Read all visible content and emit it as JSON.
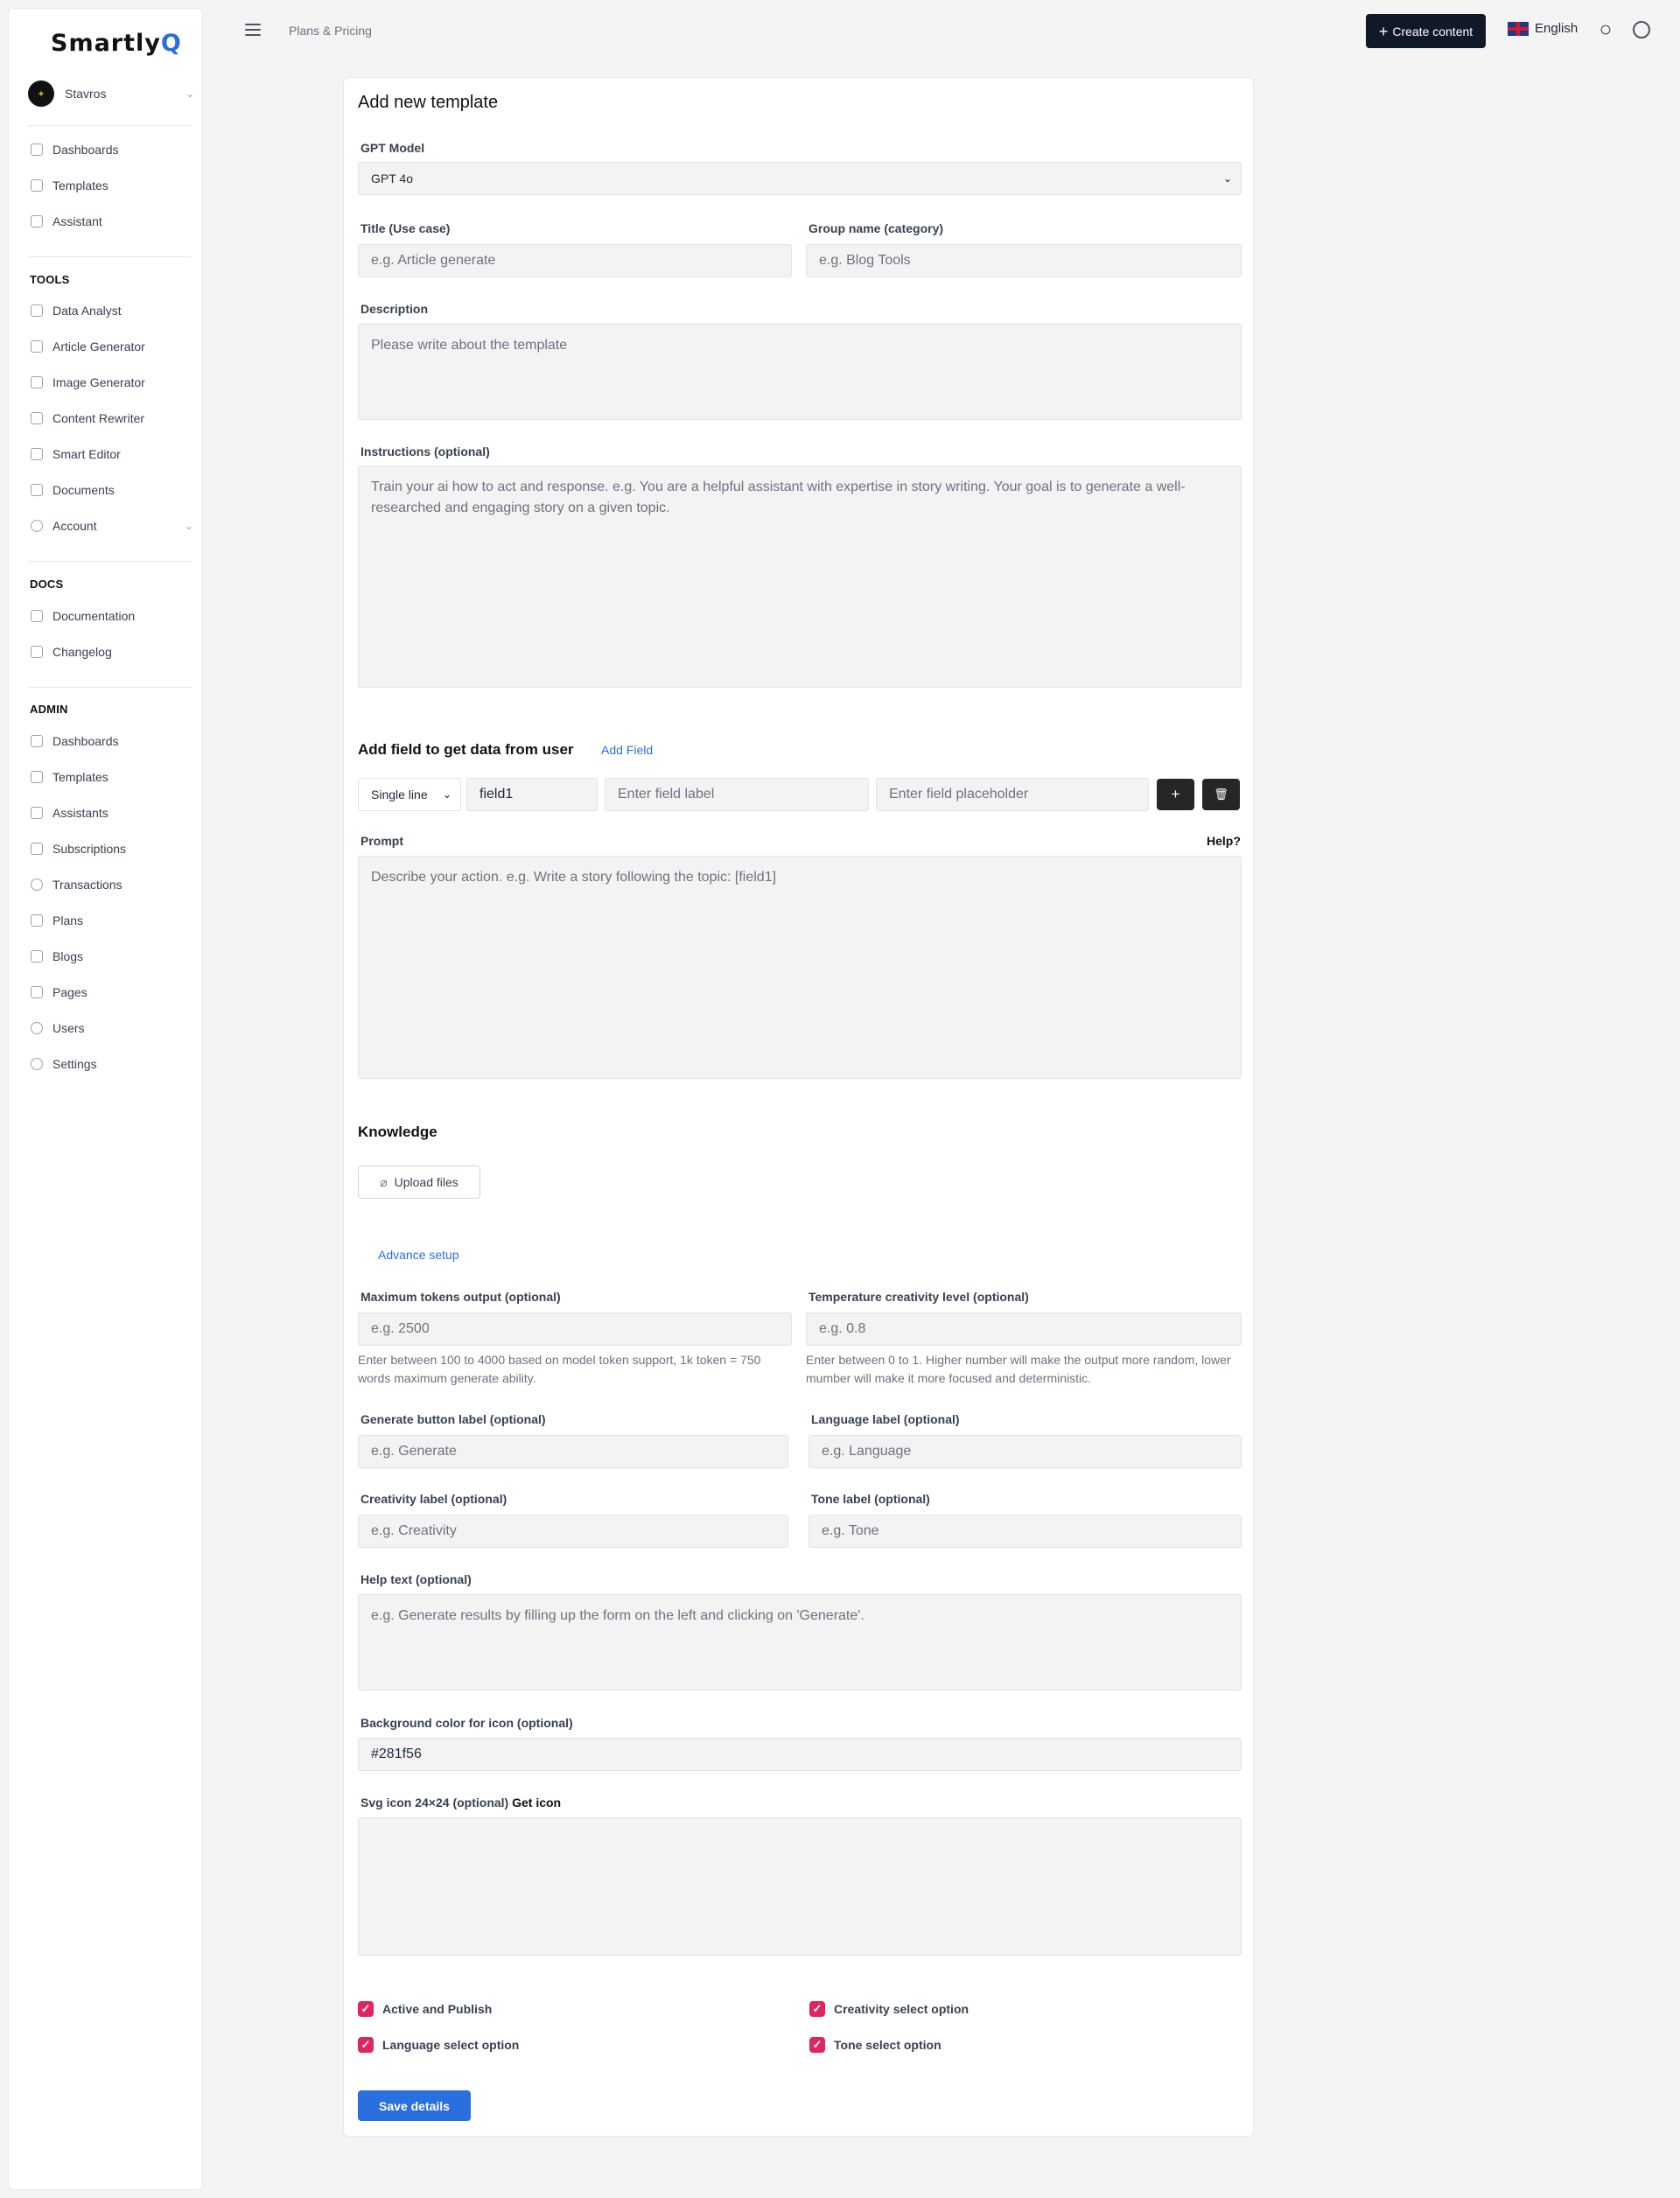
{
  "brand": {
    "name_a": "Smartly",
    "name_b": "Q"
  },
  "user": {
    "name": "Stavros"
  },
  "sidebar": {
    "main": [
      "Dashboards",
      "Templates",
      "Assistant"
    ],
    "tools_title": "TOOLS",
    "tools": [
      "Data Analyst",
      "Article Generator",
      "Image Generator",
      "Content Rewriter",
      "Smart Editor",
      "Documents",
      "Account"
    ],
    "docs_title": "DOCS",
    "docs": [
      "Documentation",
      "Changelog"
    ],
    "admin_title": "ADMIN",
    "admin": [
      "Dashboards",
      "Templates",
      "Assistants",
      "Subscriptions",
      "Transactions",
      "Plans",
      "Blogs",
      "Pages",
      "Users",
      "Settings"
    ]
  },
  "header": {
    "breadcrumb": "Plans & Pricing",
    "create_label": "Create content",
    "language": "English"
  },
  "form": {
    "title": "Add new template",
    "gpt_model_label": "GPT Model",
    "gpt_model_value": "GPT 4o",
    "title_label": "Title (Use case)",
    "title_placeholder": "e.g. Article generate",
    "group_label": "Group name (category)",
    "group_placeholder": "e.g. Blog Tools",
    "desc_label": "Description",
    "desc_placeholder": "Please write about the template",
    "instr_label": "Instructions (optional)",
    "instr_placeholder": "Train your ai how to act and response. e.g. You are a helpful assistant with expertise in story writing. Your goal is to generate a well-researched and engaging story on a given topic.",
    "add_field_title": "Add field to get data from user",
    "add_field_link": "Add Field",
    "field_type": "Single line",
    "field_name": "field1",
    "field_label_placeholder": "Enter field label",
    "field_placeholder_placeholder": "Enter field placeholder",
    "prompt_label": "Prompt",
    "help_link": "Help?",
    "prompt_placeholder": "Describe your action. e.g. Write a story following the topic: [field1]",
    "knowledge_title": "Knowledge",
    "upload_label": "Upload files",
    "advance_link": "Advance setup",
    "max_tokens_label": "Maximum tokens output (optional)",
    "max_tokens_placeholder": "e.g. 2500",
    "max_tokens_help": "Enter between 100 to 4000 based on model token support, 1k token = 750 words maximum generate ability.",
    "temp_label": "Temperature creativity level (optional)",
    "temp_placeholder": "e.g. 0.8",
    "temp_help": "Enter between 0 to 1. Higher number will make the output more random, lower mumber will make it more focused and deterministic.",
    "gen_btn_label": "Generate button label (optional)",
    "gen_btn_placeholder": "e.g. Generate",
    "lang_label": "Language label (optional)",
    "lang_placeholder": "e.g. Language",
    "creat_label": "Creativity label (optional)",
    "creat_placeholder": "e.g. Creativity",
    "tone_label": "Tone label (optional)",
    "tone_placeholder": "e.g. Tone",
    "help_text_label": "Help text (optional)",
    "help_text_placeholder": "e.g. Generate results by filling up the form on the left and clicking on 'Generate'.",
    "bg_color_label": "Background color for icon (optional)",
    "bg_color_value": "#281f56",
    "svg_label": "Svg icon 24×24 (optional)",
    "svg_link": "Get icon",
    "chk_active": "Active and Publish",
    "chk_creativity": "Creativity select option",
    "chk_language": "Language select option",
    "chk_tone": "Tone select option",
    "save_label": "Save details"
  },
  "colors": {
    "accent": "#2a6fe0",
    "checkbox": "#e0245e",
    "dark_button": "#111827"
  }
}
